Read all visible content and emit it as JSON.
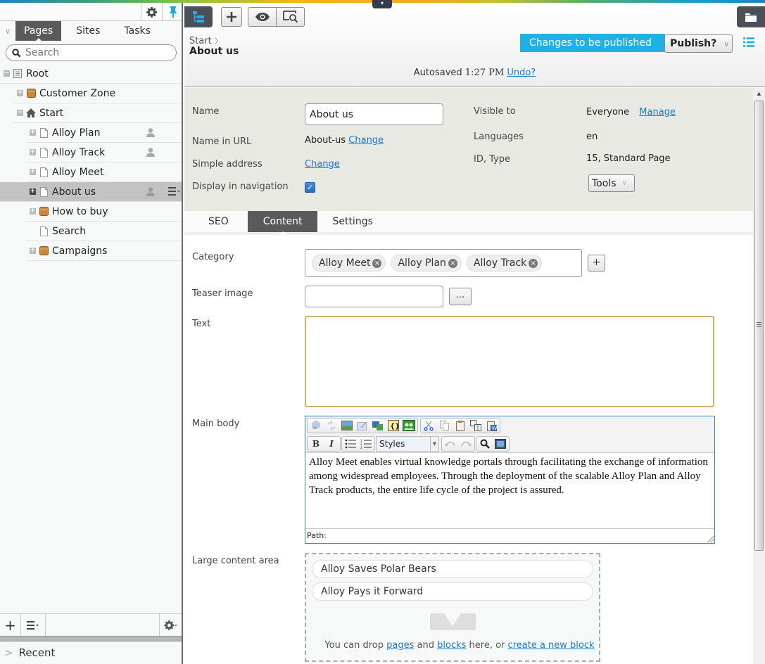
{
  "top_toggle_icon": "▾",
  "left_panel": {
    "toolbar": {
      "settings_icon": "gear-icon",
      "pin_icon": "pin-icon"
    },
    "tabs": [
      {
        "label": "Pages",
        "active": true
      },
      {
        "label": "Sites",
        "active": false
      },
      {
        "label": "Tasks",
        "active": false
      }
    ],
    "search": {
      "placeholder": "Search",
      "value": ""
    },
    "tree": [
      {
        "label": "Root",
        "level": 0,
        "expander": "−",
        "icon": "root-icon",
        "user": false,
        "selected": false
      },
      {
        "label": "Customer Zone",
        "level": 1,
        "expander": "+",
        "icon": "container-icon",
        "user": false,
        "selected": false
      },
      {
        "label": "Start",
        "level": 1,
        "expander": "−",
        "icon": "home-icon",
        "user": false,
        "selected": false
      },
      {
        "label": "Alloy Plan",
        "level": 2,
        "expander": "+",
        "icon": "page-icon",
        "user": true,
        "selected": false
      },
      {
        "label": "Alloy Track",
        "level": 2,
        "expander": "+",
        "icon": "page-icon",
        "user": true,
        "selected": false
      },
      {
        "label": "Alloy Meet",
        "level": 2,
        "expander": "+",
        "icon": "page-icon",
        "user": false,
        "selected": false
      },
      {
        "label": "About us",
        "level": 2,
        "expander": "+",
        "icon": "page-icon",
        "user": true,
        "selected": true
      },
      {
        "label": "How to buy",
        "level": 2,
        "expander": "+",
        "icon": "container-icon",
        "user": false,
        "selected": false
      },
      {
        "label": "Search",
        "level": 2,
        "expander": "",
        "icon": "page-icon",
        "user": false,
        "selected": false
      },
      {
        "label": "Campaigns",
        "level": 2,
        "expander": "+",
        "icon": "container-icon",
        "user": false,
        "selected": false
      }
    ],
    "bottom_toolbar": {
      "add_label": "+",
      "menu_icon": "list-menu-icon",
      "settings_icon": "gear-icon"
    },
    "recent": {
      "chevron": ">",
      "label": "Recent"
    }
  },
  "header": {
    "breadcrumb": {
      "parent": "Start",
      "separator": "〉"
    },
    "title": "About us",
    "status": "Changes to be published",
    "publish_label": "Publish?",
    "publish_chevron": "∨",
    "autosave": {
      "prefix": "Autosaved",
      "time": "1:27 PM",
      "undo_label": "Undo?"
    }
  },
  "settings": {
    "name_label": "Name",
    "name_value": "About us",
    "url_label": "Name in URL",
    "url_value": "About-us",
    "url_change": "Change",
    "simple_label": "Simple address",
    "simple_change": "Change",
    "nav_label": "Display in navigation",
    "nav_checked": true,
    "nav_check_glyph": "✓",
    "visible_label": "Visible to",
    "visible_value": "Everyone",
    "visible_manage": "Manage",
    "languages_label": "Languages",
    "languages_value": "en",
    "idtype_label": "ID, Type",
    "idtype_value": "15, Standard Page",
    "tools_label": "Tools",
    "tools_chevron": "∨"
  },
  "tabs": [
    {
      "label": "SEO",
      "active": false
    },
    {
      "label": "Content",
      "active": true
    },
    {
      "label": "Settings",
      "active": false
    }
  ],
  "content": {
    "category_label": "Category",
    "categories": [
      "Alloy Meet",
      "Alloy Plan",
      "Alloy Track"
    ],
    "chip_remove": "×",
    "category_add": "+",
    "teaser_label": "Teaser image",
    "teaser_value": "",
    "teaser_browse": "...",
    "text_label": "Text",
    "text_value": "",
    "mainbody_label": "Main body",
    "editor": {
      "styles_label": "Styles",
      "body": "Alloy Meet enables virtual knowledge portals through facilitating the exchange of information among widespread employees. Through the deployment of the scalable Alloy Plan and Alloy Track products, the entire life cycle of the project is assured.",
      "path_label": "Path:",
      "bold": "B",
      "italic": "I"
    },
    "lca_label": "Large content area",
    "blocks": [
      "Alloy Saves Polar Bears",
      "Alloy Pays it Forward"
    ],
    "drop": {
      "prefix": "You can drop",
      "pages_link": "pages",
      "and": "and",
      "blocks_link": "blocks",
      "middle": "here, or",
      "create_link": "create a new block"
    }
  },
  "colors": {
    "accent": "#1fb1e6",
    "dark": "#4a5057",
    "selected_row": "#c2c2c2",
    "text_field_focus": "#d5ad6a"
  }
}
